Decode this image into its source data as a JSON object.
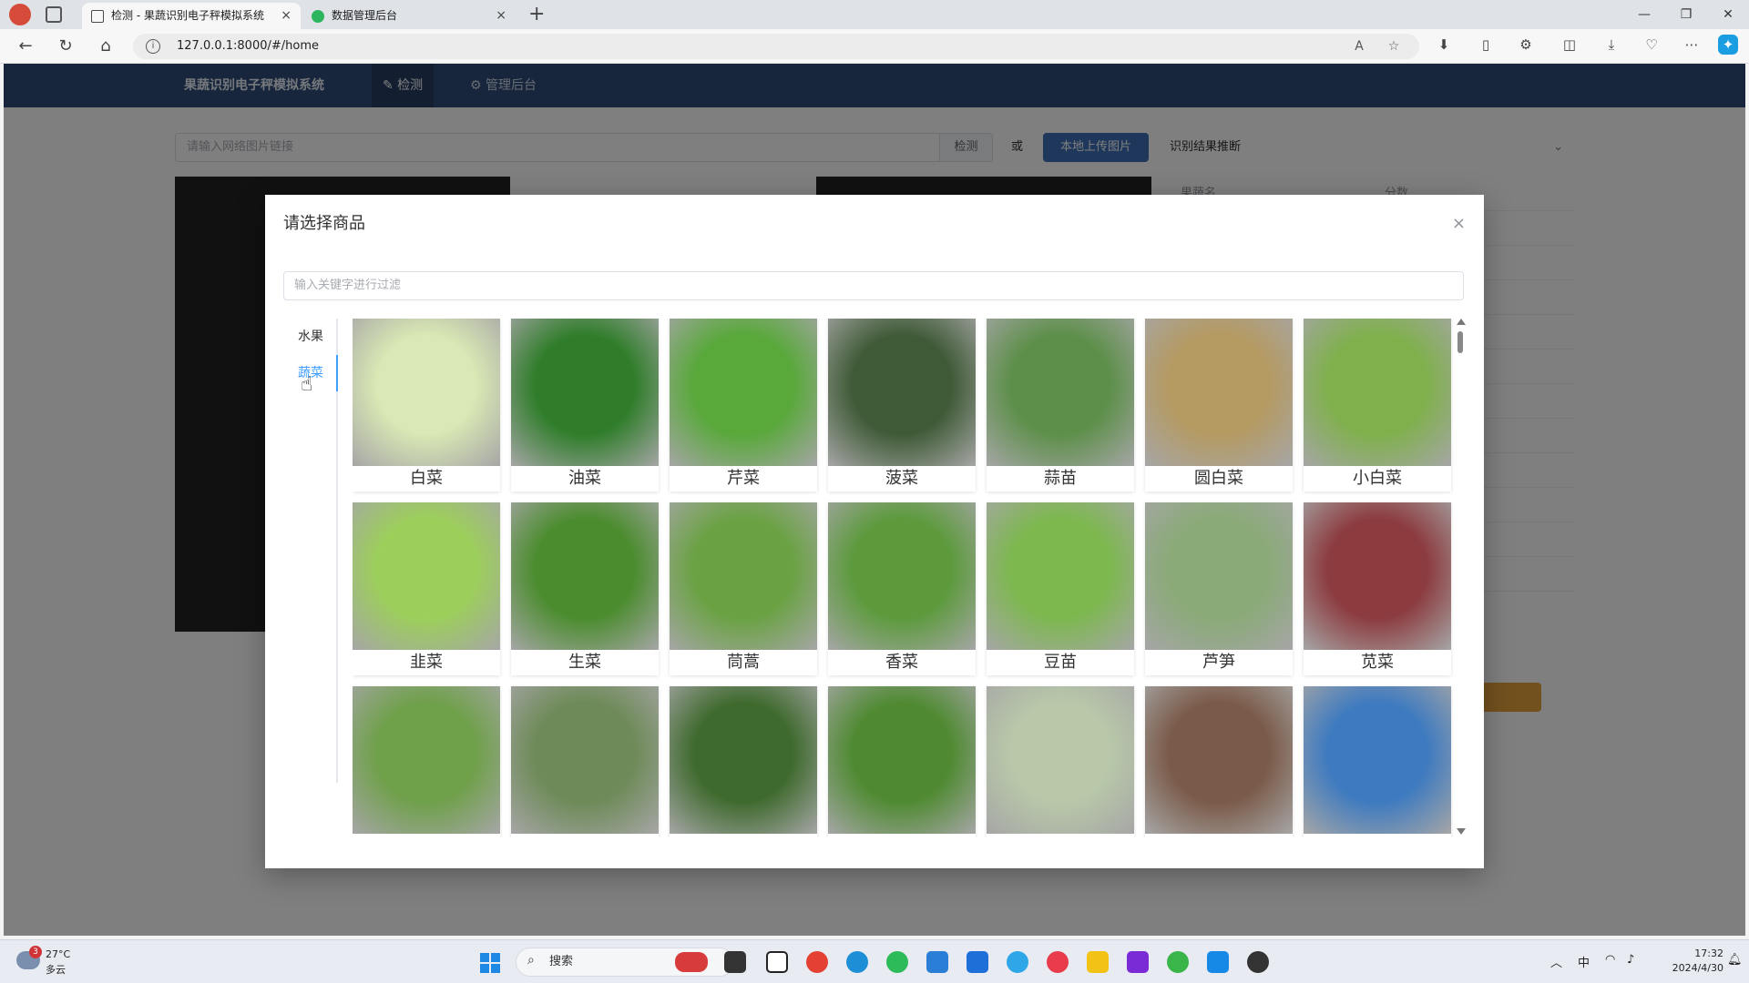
{
  "browser": {
    "tabs": [
      {
        "title": "检测 - 果蔬识别电子秤模拟系统",
        "active": true,
        "favicon_color": "#4a4a4a"
      },
      {
        "title": "数据管理后台",
        "active": false,
        "favicon_color": "#2db55d"
      }
    ],
    "close_glyph": "×",
    "new_tab_glyph": "+",
    "url": "127.0.0.1:8000/#/home"
  },
  "app": {
    "brand": "果蔬识别电子秤模拟系统",
    "menu": [
      {
        "label": "✎ 检测",
        "active": true
      },
      {
        "label": "⚙ 管理后台",
        "active": false
      }
    ],
    "url_input_placeholder": "请输入网络图片链接",
    "detect_button": "检测",
    "or_text": "或",
    "upload_button": "本地上传图片",
    "result_select": "识别结果推断",
    "table_headers": [
      "果蔬名",
      "分数"
    ]
  },
  "dialog": {
    "title": "请选择商品",
    "close_glyph": "×",
    "filter_placeholder": "输入关键字进行过滤",
    "categories": [
      {
        "label": "水果",
        "active": false
      },
      {
        "label": "蔬菜",
        "active": true
      }
    ],
    "products": [
      {
        "name": "白菜",
        "color": "#d9e8b4"
      },
      {
        "name": "油菜",
        "color": "#2f7d2a"
      },
      {
        "name": "芹菜",
        "color": "#58a83a"
      },
      {
        "name": "菠菜",
        "color": "#3f5a36"
      },
      {
        "name": "蒜苗",
        "color": "#5d8f4a"
      },
      {
        "name": "圆白菜",
        "color": "#b59a62"
      },
      {
        "name": "小白菜",
        "color": "#7fb04c"
      },
      {
        "name": "韭菜",
        "color": "#9ccf5a"
      },
      {
        "name": "生菜",
        "color": "#4b8c2e"
      },
      {
        "name": "茼蒿",
        "color": "#6aa243"
      },
      {
        "name": "香菜",
        "color": "#5c9a3c"
      },
      {
        "name": "豆苗",
        "color": "#7db84f"
      },
      {
        "name": "芦笋",
        "color": "#8aaa78"
      },
      {
        "name": "苋菜",
        "color": "#8c3b3f"
      },
      {
        "name": "",
        "color": "#6fa04a"
      },
      {
        "name": "",
        "color": "#6e8a58"
      },
      {
        "name": "",
        "color": "#3f6a2e"
      },
      {
        "name": "",
        "color": "#4f8a32"
      },
      {
        "name": "",
        "color": "#b8c8a8"
      },
      {
        "name": "",
        "color": "#7a5a48"
      },
      {
        "name": "",
        "color": "#3d7ac0"
      }
    ]
  },
  "taskbar": {
    "weather_badge": "3",
    "temperature": "27°C",
    "weather": "多云",
    "search_label": "搜索",
    "ime": "中",
    "time": "17:32",
    "date": "2024/4/30"
  }
}
